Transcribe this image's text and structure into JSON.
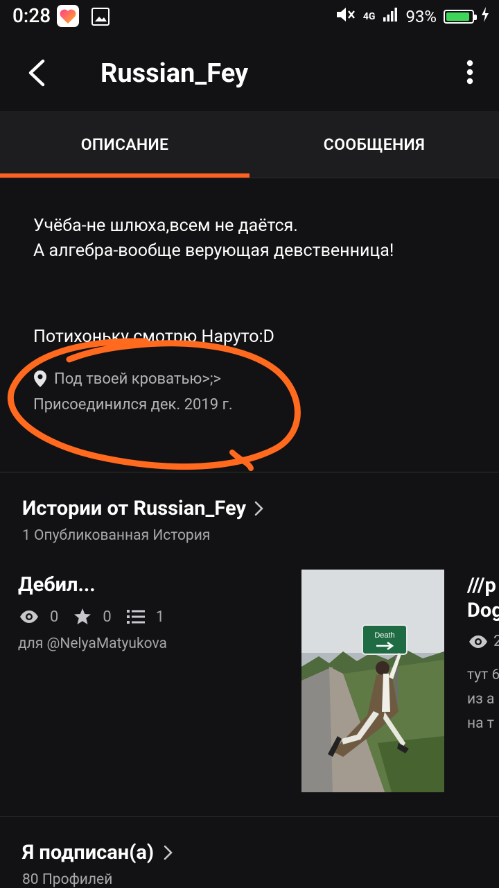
{
  "status_bar": {
    "time": "0:28",
    "network": "4G",
    "battery": "93%",
    "battery_level": 0.93,
    "icons": [
      "likee-app-icon",
      "gallery-icon",
      "mute-icon",
      "signal-icon",
      "battery-icon",
      "charging-icon"
    ]
  },
  "app_bar": {
    "title": "Russian_Fey",
    "icons": [
      "back-arrow-icon",
      "more-vert-icon"
    ]
  },
  "tabs": [
    {
      "label": "ОПИСАНИЕ",
      "active": true
    },
    {
      "label": "СООБЩЕНИЯ",
      "active": false
    }
  ],
  "accent_color": "#ff6122",
  "about": {
    "line1": "Учёба-не шлюха,всем не даётся.",
    "line2": "А алгебра-вообще верующая девственница!",
    "line3": "Потихоньку смотрю Наруто:D",
    "location": "Под твоей кроватью>;>",
    "joined": "Присоединился дек. 2019 г."
  },
  "stories_section": {
    "title": "Истории от Russian_Fey",
    "subtitle": "1 Опубликованная История"
  },
  "story": {
    "title": "Дебил...",
    "views": "0",
    "votes": "0",
    "parts": "1",
    "dedication": "для @NelyaMatyukova",
    "cover_sign": "Death"
  },
  "next_story_peek": {
    "title_line1": "///р",
    "title_line2": "Dog",
    "views": "2",
    "text_line1": "тут 6",
    "text_line2": "из а",
    "text_line3": "на т"
  },
  "following_section": {
    "title": "Я подписан(а)",
    "subtitle": "80 Профилей"
  }
}
